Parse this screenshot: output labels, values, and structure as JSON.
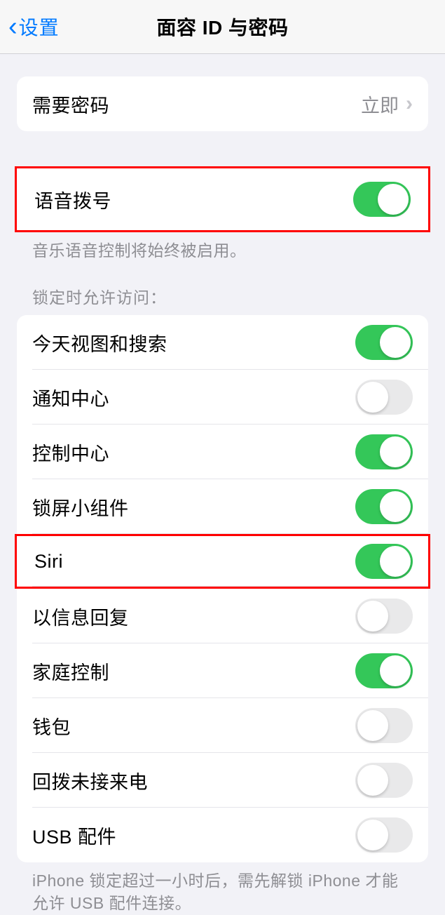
{
  "header": {
    "back_label": "设置",
    "title": "面容 ID 与密码"
  },
  "require_passcode": {
    "label": "需要密码",
    "value": "立即"
  },
  "voice_dial": {
    "label": "语音拨号",
    "on": true,
    "footer": "音乐语音控制将始终被启用。"
  },
  "allow_section": {
    "header": "锁定时允许访问：",
    "items": [
      {
        "label": "今天视图和搜索",
        "on": true
      },
      {
        "label": "通知中心",
        "on": false
      },
      {
        "label": "控制中心",
        "on": true
      },
      {
        "label": "锁屏小组件",
        "on": true
      },
      {
        "label": "Siri",
        "on": true
      },
      {
        "label": "以信息回复",
        "on": false
      },
      {
        "label": "家庭控制",
        "on": true
      },
      {
        "label": "钱包",
        "on": false
      },
      {
        "label": "回拨未接来电",
        "on": false
      },
      {
        "label": "USB 配件",
        "on": false
      }
    ],
    "footer": "iPhone 锁定超过一小时后，需先解锁 iPhone 才能允许 USB 配件连接。"
  },
  "highlighted_rows": [
    0,
    4
  ]
}
